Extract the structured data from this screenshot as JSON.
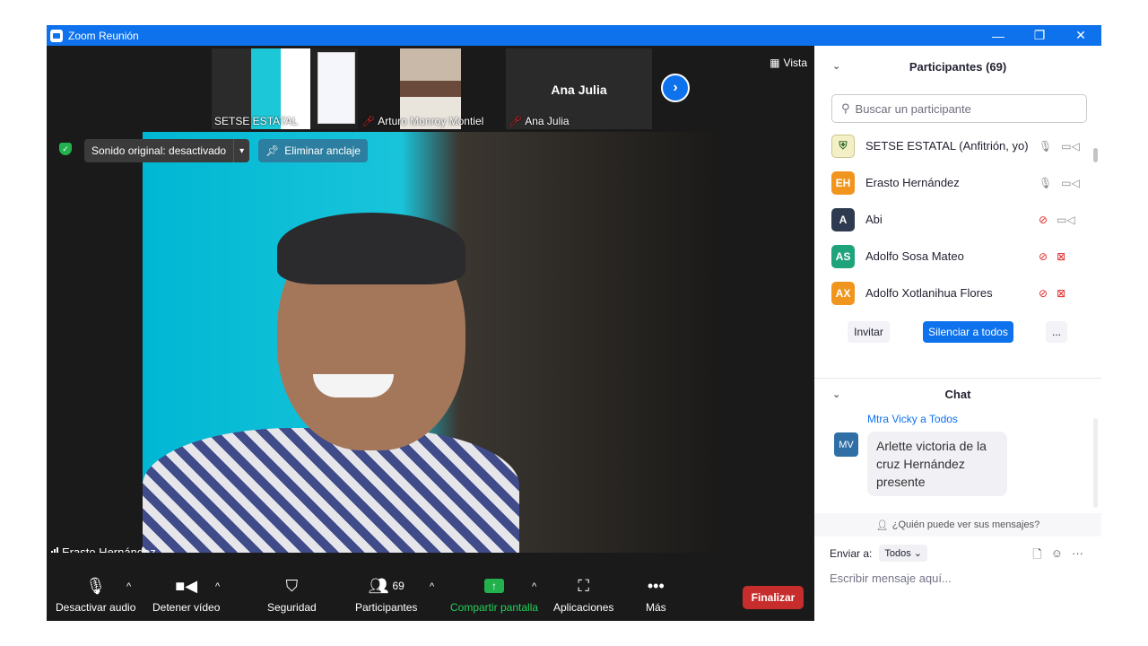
{
  "window": {
    "title": "Zoom Reunión",
    "minimize": "—",
    "restore": "❐",
    "close": "✕"
  },
  "strip": {
    "thumbs": [
      {
        "name": "SETSE ESTATAL",
        "muted": false
      },
      {
        "name": "Arturo Monroy Montiel",
        "muted": true
      },
      {
        "name": "Ana Julia",
        "muted": true
      }
    ],
    "next_icon": "chevron-right-icon",
    "view_label": "Vista"
  },
  "main_video": {
    "sound_label": "Sonido original: desactivado",
    "unpin_label": "Eliminar anclaje",
    "speaker_name": "Erasto Hernández"
  },
  "toolbar": {
    "mute_label": "Desactivar audio",
    "video_label": "Detener vídeo",
    "security_label": "Seguridad",
    "participants_label": "Participantes",
    "participants_count": "69",
    "share_label": "Compartir pantalla",
    "apps_label": "Aplicaciones",
    "more_label": "Más",
    "end_label": "Finalizar"
  },
  "participants": {
    "header": "Participantes (69)",
    "search_placeholder": "Buscar un participante",
    "list": [
      {
        "initials": "",
        "name": "SETSE ESTATAL (Anfitrión, yo)",
        "color": "#f3f0c8",
        "mic_off": false,
        "cam_off": false
      },
      {
        "initials": "EH",
        "name": "Erasto Hernández",
        "color": "#f0961e",
        "mic_off": false,
        "cam_off": false
      },
      {
        "initials": "A",
        "name": "Abi",
        "color": "#2e3a4f",
        "mic_off": true,
        "cam_off": false
      },
      {
        "initials": "AS",
        "name": "Adolfo Sosa Mateo",
        "color": "#1fa37a",
        "mic_off": true,
        "cam_off": true
      },
      {
        "initials": "AX",
        "name": "Adolfo Xotlanihua Flores",
        "color": "#f0961e",
        "mic_off": true,
        "cam_off": true
      }
    ],
    "invite_label": "Invitar",
    "mute_all_label": "Silenciar a todos",
    "more_label": "..."
  },
  "chat": {
    "header": "Chat",
    "from": "Mtra Vicky a Todos",
    "avatar": "MV",
    "message": "Arlette victoria de la cruz Hernández presente",
    "who_sees": "¿Quién puede ver sus mensajes?",
    "send_to_label": "Enviar a:",
    "send_to_value": "Todos",
    "input_placeholder": "Escribir mensaje aquí..."
  }
}
